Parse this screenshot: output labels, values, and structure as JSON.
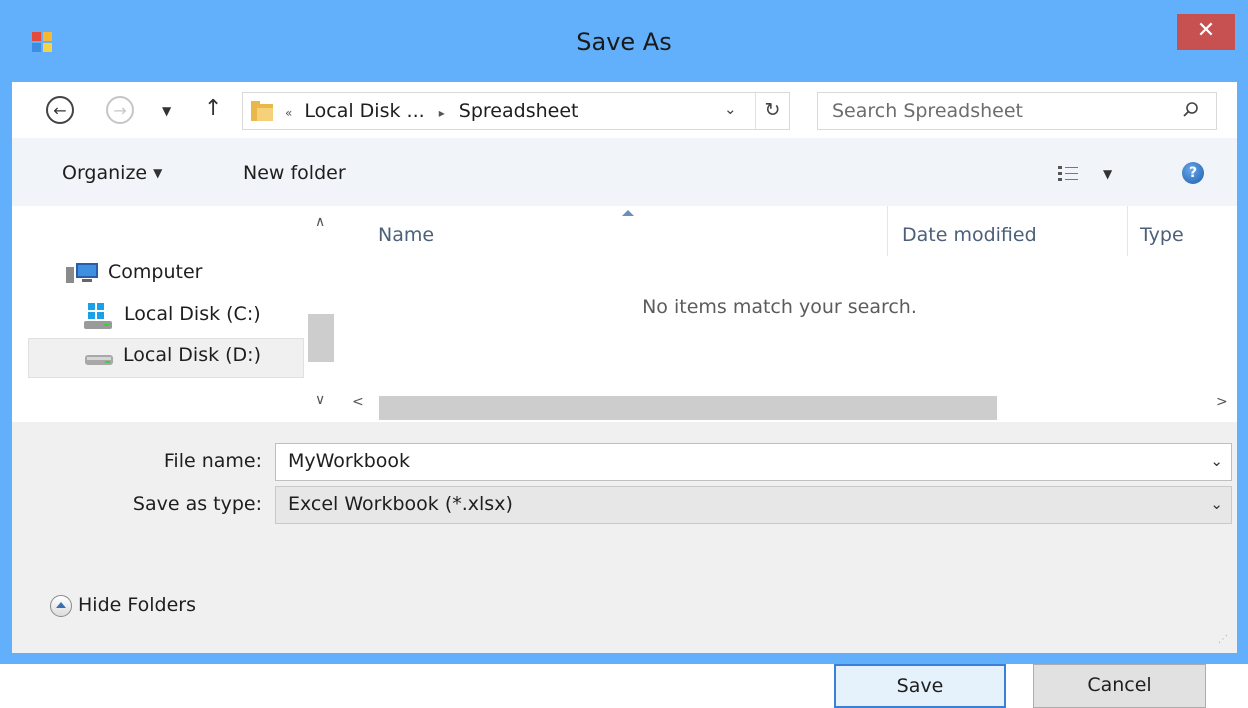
{
  "window": {
    "title": "Save As",
    "close_glyph": "✕"
  },
  "nav": {
    "back_icon": "back-arrow-icon",
    "forward_icon": "forward-arrow-icon",
    "up_icon": "up-arrow-icon",
    "breadcrumb": {
      "overflow": "«",
      "segment1": "Local Disk ...",
      "separator": "▸",
      "segment2": "Spreadsheet"
    },
    "search_placeholder": "Search Spreadsheet"
  },
  "commands": {
    "organize": "Organize",
    "new_folder": "New folder"
  },
  "tree": {
    "items": [
      {
        "label": "Computer",
        "icon": "computer-icon",
        "selected": false
      },
      {
        "label": "Local Disk (C:)",
        "icon": "system-drive-icon",
        "selected": false
      },
      {
        "label": "Local Disk (D:)",
        "icon": "drive-icon",
        "selected": true
      }
    ]
  },
  "filelist": {
    "columns": [
      "Name",
      "Date modified",
      "Type"
    ],
    "empty_message": "No items match your search."
  },
  "form": {
    "filename_label": "File name:",
    "filename_value": "MyWorkbook",
    "type_label": "Save as type:",
    "type_value": "Excel Workbook (*.xlsx)"
  },
  "footer": {
    "hide_folders": "Hide Folders",
    "save": "Save",
    "cancel": "Cancel"
  },
  "colors": {
    "titlebar": "#62b0fc",
    "close": "#c75050",
    "commandbar": "#f1f4f9",
    "default_button_border": "#3c7fd6"
  }
}
